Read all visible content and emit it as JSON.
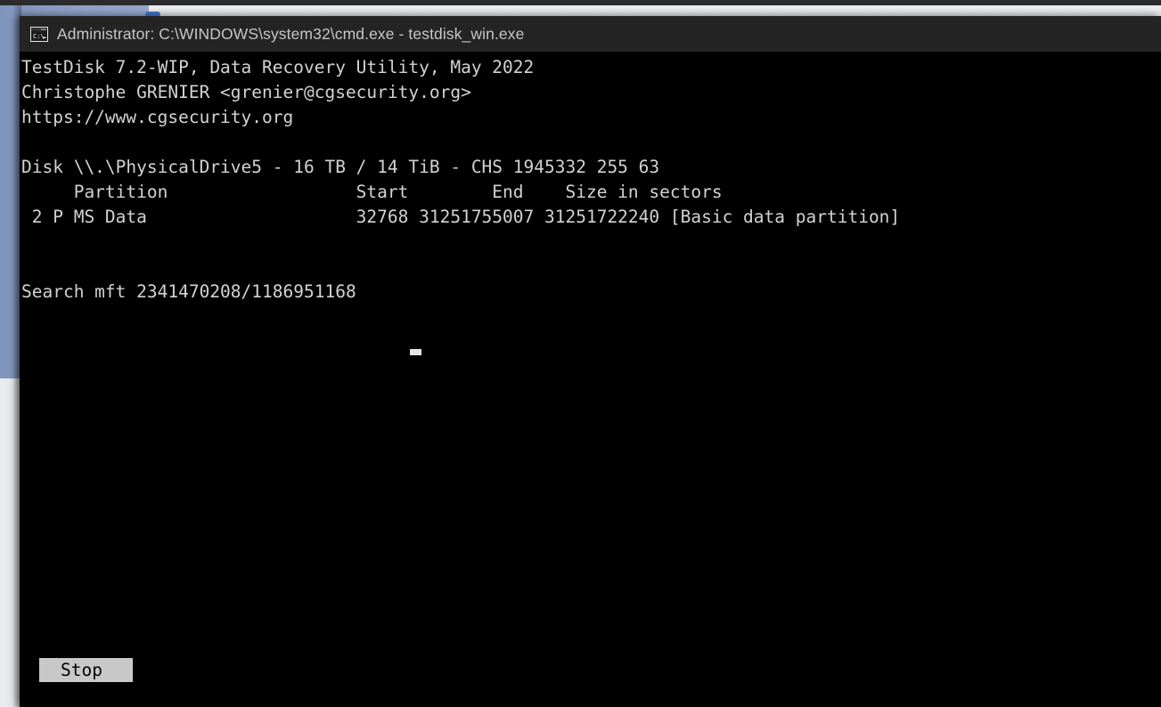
{
  "window": {
    "title": "Administrator: C:\\WINDOWS\\system32\\cmd.exe - testdisk_win.exe",
    "icon": "cmd-console-icon",
    "titlebar_color": "#242424",
    "title_text_color": "#c6c6c6",
    "background_color": "#000000",
    "foreground_color": "#d2d2d2"
  },
  "desktop": {
    "top_strip_color": "#2b2b2e",
    "left_panel_color": "#8fa2c8",
    "lower_panel_color": "#e2e5ea",
    "toolbar_color": "#e3e5e8",
    "tab_pill_color": "#3b78c8"
  },
  "terminal": {
    "lines": [
      "TestDisk 7.2-WIP, Data Recovery Utility, May 2022",
      "Christophe GRENIER <grenier@cgsecurity.org>",
      "https://www.cgsecurity.org",
      "",
      "Disk \\\\.\\PhysicalDrive5 - 16 TB / 14 TiB - CHS 1945332 255 63",
      "     Partition                  Start        End    Size in sectors",
      " 2 P MS Data                    32768 31251755007 31251722240 [Basic data partition]",
      "",
      "",
      "Search mft 2341470208/1186951168"
    ],
    "cursor": "block-cursor"
  },
  "program": {
    "name": "TestDisk",
    "version": "7.2-WIP",
    "description": "Data Recovery Utility",
    "release": "May 2022",
    "author": "Christophe GRENIER",
    "email": "<grenier@cgsecurity.org>",
    "website": "https://www.cgsecurity.org"
  },
  "disk": {
    "line": "Disk \\\\.\\PhysicalDrive5 - 16 TB / 14 TiB - CHS 1945332 255 63",
    "device": "\\\\.\\PhysicalDrive5",
    "size_tb": "16 TB",
    "size_tib": "14 TiB",
    "chs": "CHS 1945332 255 63"
  },
  "partition_table": {
    "headers": {
      "partition": "Partition",
      "start": "Start",
      "end": "End",
      "size": "Size in sectors"
    },
    "rows": [
      {
        "index": "2",
        "status": "P",
        "type": "MS Data",
        "start": "32768",
        "end": "31251755007",
        "size_in_sectors": "31251722240",
        "label": "[Basic data partition]"
      }
    ]
  },
  "status": {
    "operation": "Search mft",
    "progress_text": "Search mft 2341470208/1186951168",
    "current": "2341470208",
    "total": "1186951168"
  },
  "buttons": {
    "stop_label": "Stop"
  }
}
